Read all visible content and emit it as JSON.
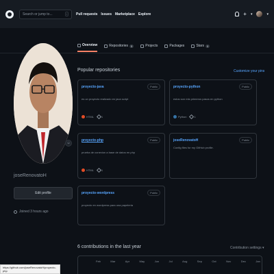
{
  "header": {
    "search_placeholder": "Search or jump to...",
    "search_shortcut": "/",
    "nav": [
      "Pull requests",
      "Issues",
      "Marketplace",
      "Explore"
    ]
  },
  "tabs": [
    {
      "label": "Overview",
      "count": ""
    },
    {
      "label": "Repositories",
      "count": "5"
    },
    {
      "label": "Projects",
      "count": ""
    },
    {
      "label": "Packages",
      "count": ""
    },
    {
      "label": "Stars",
      "count": "0"
    }
  ],
  "profile": {
    "username": "joseRenovatoH",
    "edit_label": "Edit profile",
    "joined": "Joined 3 hours ago"
  },
  "popular": {
    "title": "Popular repositories",
    "customize": "Customize your pins",
    "repos": [
      {
        "name": "proyecto-java",
        "visibility": "Public",
        "description": "es un proyecto realizado en java script",
        "language": "HTML",
        "lang_color": "#e34c26",
        "stars": "1"
      },
      {
        "name": "proyecto-python",
        "visibility": "Public",
        "description": "estos son mis primeros pasos en python",
        "language": "Python",
        "lang_color": "#3572A5",
        "stars": "1"
      },
      {
        "name": "proyecto-php",
        "visibility": "Public",
        "description": "prueba de conexion a base de datos en php",
        "language": "HTML",
        "lang_color": "#e34c26",
        "stars": "1"
      },
      {
        "name": "joseRenovatoH",
        "visibility": "Public",
        "description": "Config files for my GitHub profile.",
        "language": "",
        "lang_color": "",
        "stars": ""
      },
      {
        "name": "proyecto-wordpress",
        "visibility": "Public",
        "description": "proyecto en wordpress para una papeleria",
        "language": "",
        "lang_color": "",
        "stars": ""
      }
    ]
  },
  "contributions": {
    "title": "6 contributions in the last year",
    "settings": "Contribution settings ▾",
    "months": [
      "Feb",
      "Mar",
      "Apr",
      "May",
      "Jun",
      "Jul",
      "Aug",
      "Sep",
      "Oct",
      "Nov",
      "Dec",
      "Jan"
    ]
  },
  "status_bar": {
    "url": "https://github.com/joseRenovatoH/proyecto-php"
  }
}
